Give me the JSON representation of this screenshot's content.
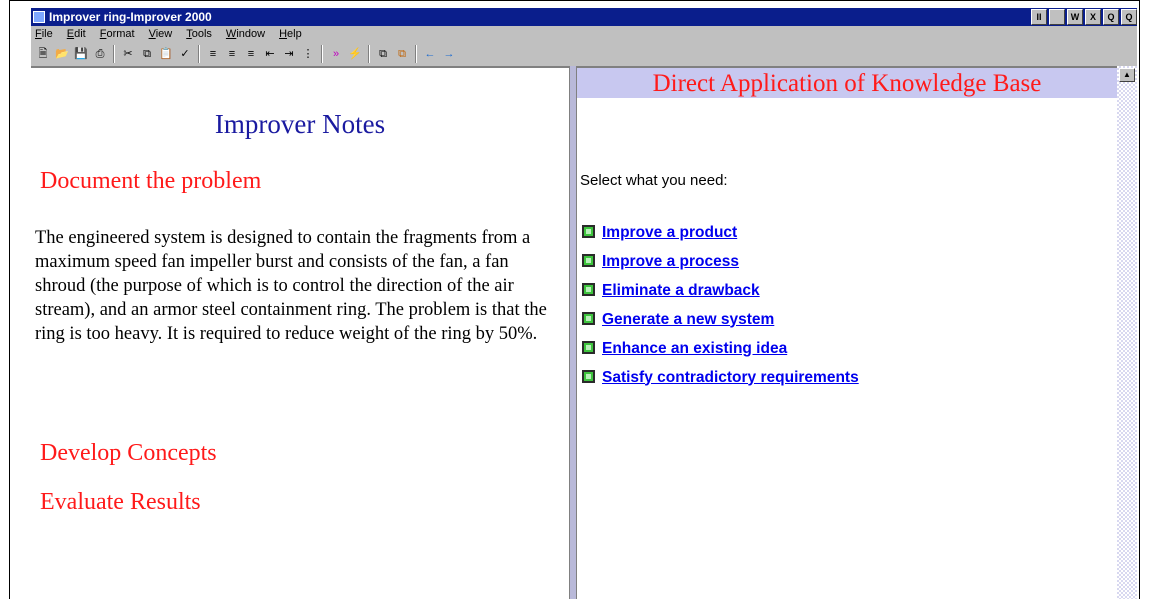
{
  "window": {
    "title": "Improver ring-Improver 2000"
  },
  "titlebar_buttons": [
    "II",
    "W",
    "X",
    "Q",
    "Q"
  ],
  "menu": [
    "File",
    "Edit",
    "Format",
    "View",
    "Tools",
    "Window",
    "Help"
  ],
  "toolbar": {
    "icons": [
      "new-document-icon",
      "open-folder-icon",
      "save-icon",
      "print-icon",
      "cut-icon",
      "copy-icon",
      "paste-icon",
      "spellcheck-icon",
      "align-left-icon",
      "align-center-icon",
      "align-right-icon",
      "outdent-icon",
      "indent-icon",
      "bullet-list-icon",
      "next-icon",
      "lightning-icon",
      "window-a-icon",
      "window-b-icon",
      "back-arrow-icon",
      "forward-arrow-icon"
    ]
  },
  "notes": {
    "title": "Improver Notes",
    "section1": "Document the problem",
    "paragraph": "The engineered system is designed to contain the fragments from a maximum speed fan impeller burst and consists of the fan, a fan shroud (the purpose of which is to control the direction of the air stream), and an armor steel containment ring.  The problem is that the ring is too heavy.  It is required to reduce weight of the ring by 50%.",
    "section2": "Develop Concepts",
    "section3": "Evaluate Results"
  },
  "knowledge": {
    "banner": "Direct Application of Knowledge Base",
    "prompt": "Select what you need:",
    "links": [
      "Improve a product",
      "Improve a process",
      "Eliminate a drawback",
      "Generate a new system",
      "Enhance an existing idea",
      "Satisfy contradictory requirements"
    ]
  },
  "colors": {
    "heading_red": "#ff1a1a",
    "title_blue": "#1a1aa0",
    "link_blue": "#0000ee",
    "banner_bg": "#c8c8f0",
    "titlebar": "#0a1e8c"
  }
}
